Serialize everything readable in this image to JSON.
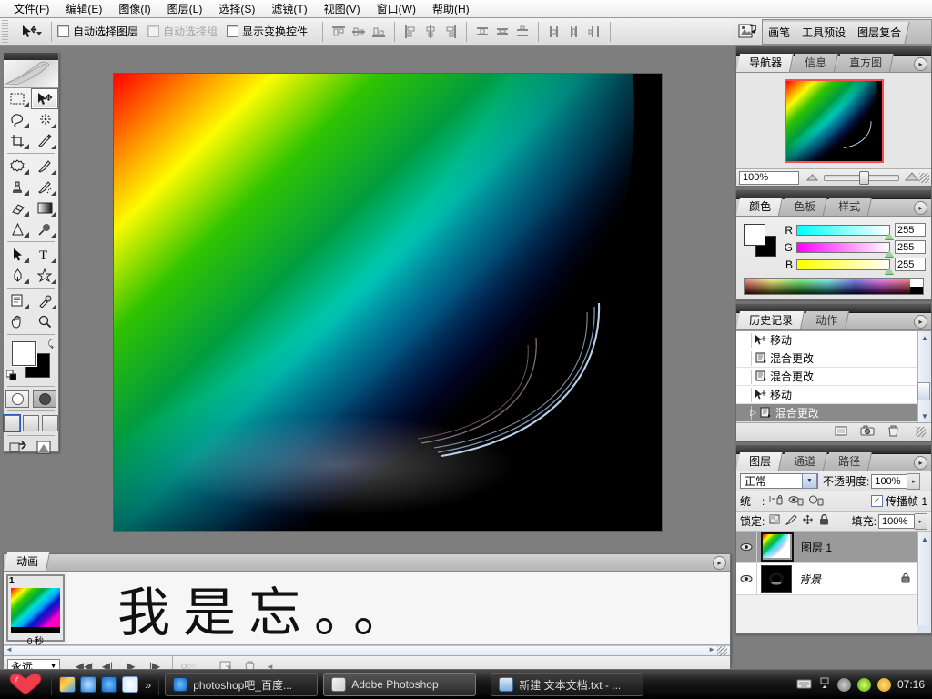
{
  "menu": {
    "items": [
      "文件(F)",
      "编辑(E)",
      "图像(I)",
      "图层(L)",
      "选择(S)",
      "滤镜(T)",
      "视图(V)",
      "窗口(W)",
      "帮助(H)"
    ]
  },
  "options_bar": {
    "tool": "move-tool",
    "checkboxes": [
      {
        "label": "自动选择图层",
        "checked": false,
        "enabled": true
      },
      {
        "label": "自动选择组",
        "checked": false,
        "enabled": false
      },
      {
        "label": "显示变换控件",
        "checked": false,
        "enabled": true
      }
    ]
  },
  "panel_well": {
    "tabs": [
      "画笔",
      "工具预设",
      "图层复合"
    ]
  },
  "navigator": {
    "tabs": [
      "导航器",
      "信息",
      "直方图"
    ],
    "active_tab": "导航器",
    "zoom": "100%"
  },
  "color": {
    "tabs": [
      "颜色",
      "色板",
      "样式"
    ],
    "active_tab": "颜色",
    "channels": [
      {
        "label": "R",
        "value": "255",
        "ramp_from": "#00ffff",
        "ramp_to": "#ffffff"
      },
      {
        "label": "G",
        "value": "255",
        "ramp_from": "#ff00ff",
        "ramp_to": "#ffffff"
      },
      {
        "label": "B",
        "value": "255",
        "ramp_from": "#ffff00",
        "ramp_to": "#ffffff"
      }
    ],
    "foreground": "#ffffff",
    "background": "#000000"
  },
  "history": {
    "tabs": [
      "历史记录",
      "动作"
    ],
    "active_tab": "历史记录",
    "entries": [
      {
        "label": "移动",
        "icon": "move-state-icon",
        "selected": false
      },
      {
        "label": "混合更改",
        "icon": "blend-state-icon",
        "selected": false
      },
      {
        "label": "混合更改",
        "icon": "blend-state-icon",
        "selected": false
      },
      {
        "label": "移动",
        "icon": "move-state-icon",
        "selected": false
      },
      {
        "label": "混合更改",
        "icon": "blend-state-icon",
        "selected": true
      }
    ],
    "footer_buttons": [
      "new-document-from-state",
      "new-snapshot",
      "delete-state"
    ]
  },
  "layers": {
    "tabs": [
      "图层",
      "通道",
      "路径"
    ],
    "active_tab": "图层",
    "blend_mode": "正常",
    "opacity_label": "不透明度:",
    "opacity_value": "100%",
    "unify_label": "统一:",
    "propagate_label": "传播帧 1",
    "propagate_checked": true,
    "lock_label": "锁定:",
    "fill_label": "填充:",
    "fill_value": "100%",
    "items": [
      {
        "name": "图层 1",
        "selected": true,
        "visible": true,
        "locked": false,
        "thumb": "rainbow"
      },
      {
        "name": "背景",
        "selected": false,
        "visible": true,
        "locked": true,
        "thumb": "dark"
      }
    ]
  },
  "animation": {
    "tabs": [
      "动画"
    ],
    "active_tab": "动画",
    "frames": [
      {
        "number": "1",
        "duration": "0 秒"
      }
    ],
    "loop": "永远",
    "controls": [
      "select-first-frame",
      "select-previous-frame",
      "play-animation",
      "select-next-frame",
      "tween",
      "duplicate-frame",
      "delete-frame"
    ],
    "artboard_text": "我是忘。。"
  },
  "canvas": {
    "title": "rainbow-gradient-document"
  },
  "taskbar": {
    "quick_launch": [
      "desktop-icon",
      "ie-icon",
      "maxthon-icon",
      "kingsoft-icon"
    ],
    "overflow": "»",
    "tasks": [
      {
        "label": "photoshop吧_百度...",
        "icon": "maxthon-icon",
        "active": false
      },
      {
        "label": "Adobe Photoshop",
        "icon": "photoshop-icon",
        "active": true
      },
      {
        "label": "新建 文本文档.txt - ...",
        "icon": "notepad-icon",
        "active": false
      }
    ],
    "clock": "07:16",
    "tray": [
      "volume-icon",
      "update-icon",
      "shield-icon"
    ]
  },
  "colors": {
    "accent": "#316ac5",
    "panel_bg": "#e8e8e8",
    "app_bg": "#7e7e7e",
    "selection": "#8a8a8a"
  }
}
